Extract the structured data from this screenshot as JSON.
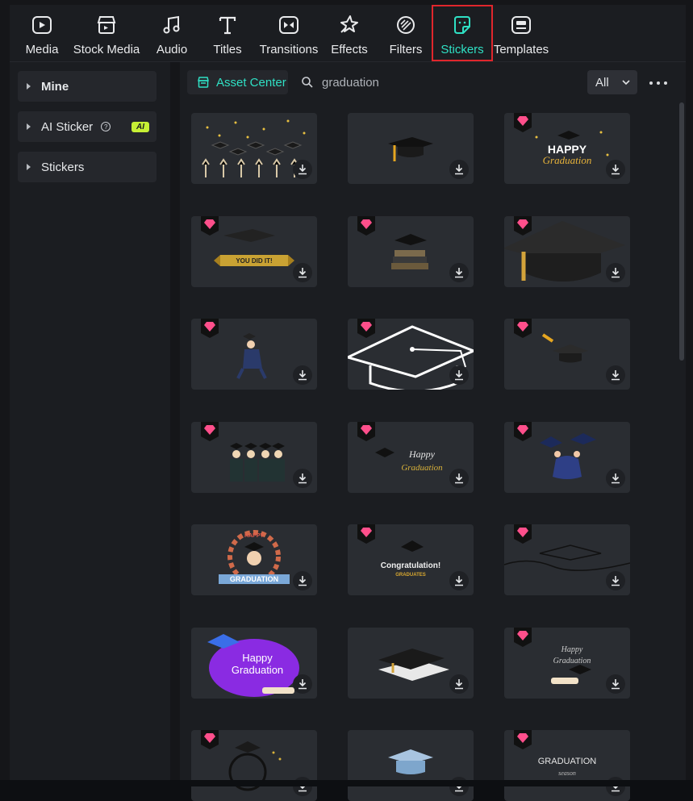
{
  "toolbar": {
    "tabs": [
      {
        "label": "Media",
        "icon": "media-icon"
      },
      {
        "label": "Stock Media",
        "icon": "stock-media-icon"
      },
      {
        "label": "Audio",
        "icon": "music-note-icon"
      },
      {
        "label": "Titles",
        "icon": "text-t-icon"
      },
      {
        "label": "Transitions",
        "icon": "transitions-icon"
      },
      {
        "label": "Effects",
        "icon": "effects-sparkle-icon"
      },
      {
        "label": "Filters",
        "icon": "filters-icon"
      },
      {
        "label": "Stickers",
        "icon": "sticker-icon",
        "active": true
      },
      {
        "label": "Templates",
        "icon": "templates-icon"
      }
    ],
    "accent_color": "#2fe0c4",
    "highlight_color": "#e0262c"
  },
  "left_panel": {
    "items": [
      {
        "label": "Mine"
      },
      {
        "label": "AI Sticker",
        "badge": "AI",
        "help": "?"
      },
      {
        "label": "Stickers"
      }
    ]
  },
  "main": {
    "asset_center_label": "Asset Center",
    "search_value": "graduation",
    "filter_value": "All",
    "premium_color": "#ff4f8b",
    "stickers": [
      {
        "name": "caps-and-hands",
        "premium": false,
        "caption": ""
      },
      {
        "name": "graduation-cap",
        "premium": false,
        "caption": ""
      },
      {
        "name": "happy-graduation",
        "premium": true,
        "caption": "HAPPY Graduation"
      },
      {
        "name": "you-did-it-banner",
        "premium": true,
        "caption": "YOU DID IT!"
      },
      {
        "name": "cap-on-books",
        "premium": true,
        "caption": ""
      },
      {
        "name": "large-cap",
        "premium": true,
        "caption": ""
      },
      {
        "name": "jumping-graduate",
        "premium": true,
        "caption": ""
      },
      {
        "name": "outline-cap",
        "premium": true,
        "caption": ""
      },
      {
        "name": "small-cap",
        "premium": true,
        "caption": ""
      },
      {
        "name": "graduates-group",
        "premium": true,
        "caption": ""
      },
      {
        "name": "cap-script",
        "premium": true,
        "caption": ""
      },
      {
        "name": "caps-tossed",
        "premium": true,
        "caption": ""
      },
      {
        "name": "laurel-graduation",
        "premium": false,
        "caption": "GRADUATION",
        "caption2": "HAPPY"
      },
      {
        "name": "congratulation",
        "premium": true,
        "caption": "Congratulation!",
        "caption2": "GRADUATES"
      },
      {
        "name": "line-cap",
        "premium": true,
        "caption": ""
      },
      {
        "name": "happy-graduation-purple",
        "premium": false,
        "caption": "Happy",
        "caption2": "Graduation"
      },
      {
        "name": "3d-cap",
        "premium": false,
        "caption": ""
      },
      {
        "name": "cap-diploma-script",
        "premium": true,
        "caption": ""
      },
      {
        "name": "wreath-cap",
        "premium": true,
        "caption": ""
      },
      {
        "name": "blue-cap",
        "premium": false,
        "caption": ""
      },
      {
        "name": "graduation-season",
        "premium": true,
        "caption": "GRADUATION",
        "caption2": "season"
      }
    ]
  }
}
